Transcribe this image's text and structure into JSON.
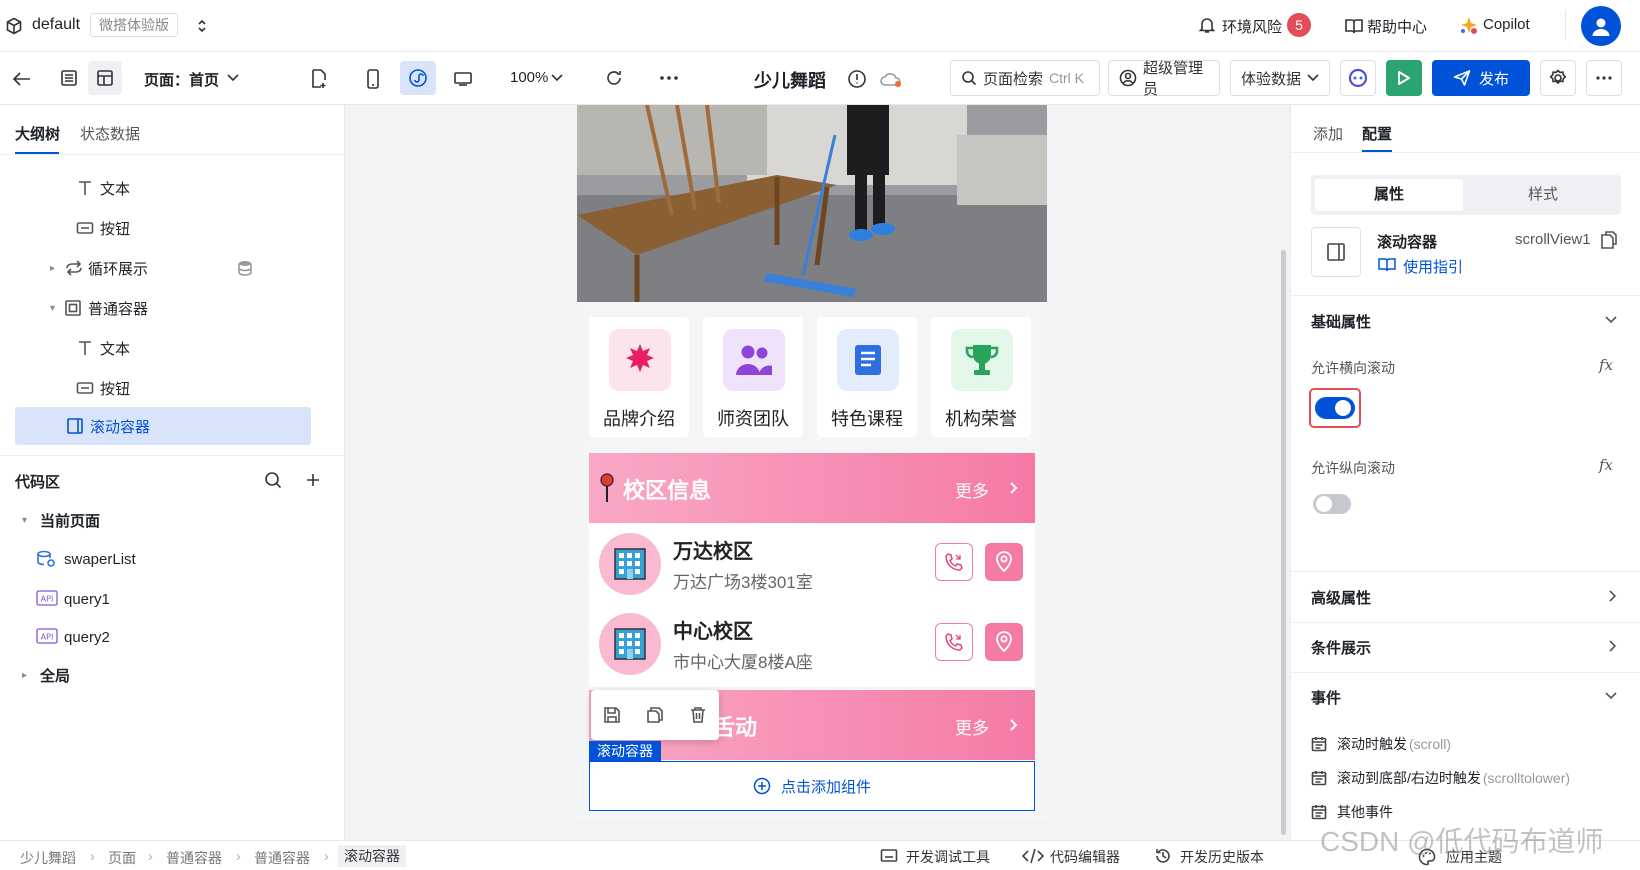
{
  "topbar": {
    "workspace": "default",
    "edition_badge": "微搭体验版",
    "env_risk_label": "环境风险",
    "env_risk_count": "5",
    "help_label": "帮助中心",
    "copilot_label": "Copilot"
  },
  "toolbar": {
    "page_label": "页面：首页",
    "zoom": "100%",
    "app_title": "少儿舞蹈",
    "search_label": "页面检索",
    "search_shortcut": "Ctrl K",
    "admin_label": "超级管理员",
    "data_label": "体验数据",
    "publish_label": "发布"
  },
  "left": {
    "tabs": [
      "大纲树",
      "状态数据"
    ],
    "tree": [
      {
        "label": "文本",
        "icon": "text-icon"
      },
      {
        "label": "按钮",
        "icon": "button-icon"
      },
      {
        "label": "循环展示",
        "icon": "loop-icon"
      },
      {
        "label": "普通容器",
        "icon": "container-icon"
      },
      {
        "label": "文本",
        "icon": "text-icon"
      },
      {
        "label": "按钮",
        "icon": "button-icon"
      },
      {
        "label": "滚动容器",
        "icon": "scroll-container-icon"
      }
    ],
    "code_title": "代码区",
    "current_page": "当前页面",
    "code_items": [
      "swaperList",
      "query1",
      "query2"
    ],
    "global": "全局"
  },
  "phone": {
    "nav": [
      {
        "label": "品牌介绍",
        "color": "#fce4ef",
        "fg": "#e91e63"
      },
      {
        "label": "师资团队",
        "color": "#efe3fb",
        "fg": "#8e44d6"
      },
      {
        "label": "特色课程",
        "color": "#e3ecfc",
        "fg": "#2f6fe0"
      },
      {
        "label": "机构荣誉",
        "color": "#e2f6ea",
        "fg": "#27a35a"
      }
    ],
    "campus_title": "校区信息",
    "more": "更多",
    "campuses": [
      {
        "name": "万达校区",
        "addr": "万达广场3楼301室"
      },
      {
        "name": "中心校区",
        "addr": "市中心大厦8楼A座"
      }
    ],
    "activity_title_partial": "舌动",
    "scroll_tag": "滚动容器",
    "add_component": "点击添加组件"
  },
  "right": {
    "tabs": [
      "添加",
      "配置"
    ],
    "seg": [
      "属性",
      "样式"
    ],
    "component_name": "滚动容器",
    "component_id": "scrollView1",
    "guide": "使用指引",
    "basic_props": "基础属性",
    "allow_h": "允许横向滚动",
    "allow_h_on": 1,
    "allow_v": "允许纵向滚动",
    "allow_v_on": 0,
    "advanced": "高级属性",
    "conditional": "条件展示",
    "events": "事件",
    "event_items": [
      {
        "label": "滚动时触发",
        "code": "(scroll)"
      },
      {
        "label": "滚动到底部/右边时触发",
        "code": "(scrolltolower)"
      },
      {
        "label": "其他事件",
        "code": ""
      }
    ]
  },
  "bottom": {
    "crumbs": [
      "少儿舞蹈",
      "页面",
      "普通容器",
      "普通容器",
      "滚动容器"
    ],
    "devtools": "开发调试工具",
    "code_editor": "代码编辑器",
    "history": "开发历史版本",
    "theme": "应用主题",
    "watermark": "CSDN @低代码布道师"
  },
  "colors": {
    "accent": "#0052d9",
    "pink": "#f57aa6",
    "green": "#2ba471",
    "badge_red": "#e34d59"
  }
}
